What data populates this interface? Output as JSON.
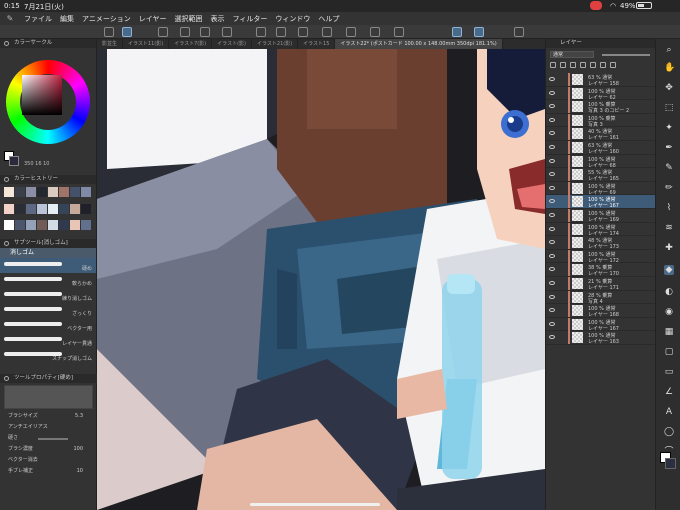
{
  "status_bar": {
    "time": "0:15",
    "date": "7月21日(火)",
    "battery": "49%"
  },
  "menu": [
    "ファイル",
    "編集",
    "アニメーション",
    "レイヤー",
    "選択範囲",
    "表示",
    "フィルター",
    "ウィンドウ",
    "ヘルプ"
  ],
  "left_panel": {
    "color_circle_title": "カラーサークル",
    "hsv_readout": "350 16 10",
    "color_history_title": "カラーヒストリー",
    "history_colors": [
      "#f5e6da",
      "#3a3f4a",
      "#8a8fa6",
      "#23272f",
      "#d9cbbf",
      "#a07468",
      "#45506a",
      "#7e8aa6",
      "#f2d2c8",
      "#2b2d36",
      "#5d6882",
      "#b9c4d8",
      "#e6eef5",
      "#344459",
      "#c7a99b",
      "#1f2029",
      "#ffffff",
      "#4b556e",
      "#93a1b9",
      "#705b59",
      "#d3dbe6",
      "#2f3a4f",
      "#e8c5b5",
      "#61708c"
    ],
    "subtool_title": "サブツール[消しゴム]",
    "subtool_tab": "消しゴム",
    "brushes": [
      {
        "label": "硬め",
        "selected": true
      },
      {
        "label": "軟らかめ",
        "selected": false
      },
      {
        "label": "練り消しゴム",
        "selected": false
      },
      {
        "label": "ざっくり",
        "selected": false
      },
      {
        "label": "ベクター用",
        "selected": false
      },
      {
        "label": "レイヤー貫通",
        "selected": false
      },
      {
        "label": "スナップ消しゴム",
        "selected": false
      }
    ],
    "tool_property_title": "ツールプロパティ[硬め]",
    "props": {
      "brush_size_label": "ブラシサイズ",
      "brush_size_value": "5.3",
      "antialias_label": "アンチエイリアス",
      "hardness_label": "硬さ",
      "density_label": "ブラシ濃度",
      "density_value": "100",
      "vector_label": "ベクター消去",
      "stabilization_label": "手ブレ補正",
      "stabilization_value": "10"
    }
  },
  "doc_tabs": [
    {
      "label": "影並生",
      "active": false
    },
    {
      "label": "イラスト11(影)",
      "active": false
    },
    {
      "label": "イラスト7(影)",
      "active": false
    },
    {
      "label": "イラスト(影)",
      "active": false
    },
    {
      "label": "イラスト21(影)",
      "active": false
    },
    {
      "label": "イラスト15",
      "active": false
    },
    {
      "label": "イラスト22* (ポストカード 100.00 x 148.00mm 350dpi 181.1%)",
      "active": true
    }
  ],
  "right_panel": {
    "layer_title": "レイヤー",
    "blend_mode": "通常",
    "layers": [
      {
        "mode": "63 % 通常",
        "name": "レイヤー 158",
        "selected": false
      },
      {
        "mode": "100 % 通常",
        "name": "レイヤー 62",
        "selected": false
      },
      {
        "mode": "100 % 乗算",
        "name": "写真 3 のコピー 2",
        "selected": false
      },
      {
        "mode": "100 % 乗算",
        "name": "写真 3",
        "selected": false
      },
      {
        "mode": "40 % 通常",
        "name": "レイヤー 161",
        "selected": false
      },
      {
        "mode": "63 % 通常",
        "name": "レイヤー 160",
        "selected": false
      },
      {
        "mode": "100 % 通常",
        "name": "レイヤー 68",
        "selected": false
      },
      {
        "mode": "55 % 通常",
        "name": "レイヤー 165",
        "selected": false
      },
      {
        "mode": "100 % 通常",
        "name": "レイヤー 69",
        "selected": false
      },
      {
        "mode": "100 % 通常",
        "name": "レイヤー 167",
        "selected": true
      },
      {
        "mode": "100 % 通常",
        "name": "レイヤー 169",
        "selected": false
      },
      {
        "mode": "100 % 通常",
        "name": "レイヤー 174",
        "selected": false
      },
      {
        "mode": "48 % 通常",
        "name": "レイヤー 173",
        "selected": false
      },
      {
        "mode": "100 % 通常",
        "name": "レイヤー 172",
        "selected": false
      },
      {
        "mode": "38 % 乗算",
        "name": "レイヤー 170",
        "selected": false
      },
      {
        "mode": "21 % 乗算",
        "name": "レイヤー 171",
        "selected": false
      },
      {
        "mode": "28 % 乗算",
        "name": "写真 4",
        "selected": false
      },
      {
        "mode": "100 % 通常",
        "name": "レイヤー 168",
        "selected": false
      },
      {
        "mode": "100 % 通常",
        "name": "レイヤー 167",
        "selected": false
      },
      {
        "mode": "100 % 通常",
        "name": "レイヤー 163",
        "selected": false
      }
    ]
  }
}
